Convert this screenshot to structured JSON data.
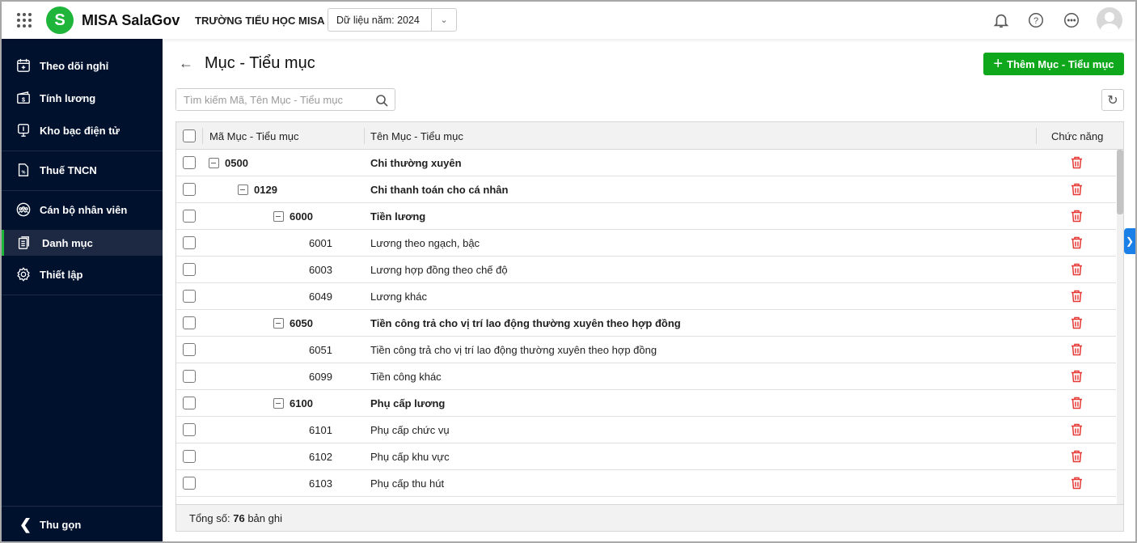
{
  "header": {
    "app_name": "MISA SalaGov",
    "school": "TRƯỜNG TIỂU HỌC MISA",
    "year_label": "Dữ liệu năm:",
    "year": "2024"
  },
  "sidebar": {
    "items": [
      {
        "label": "Theo dõi nghỉ",
        "icon": "calendar-icon"
      },
      {
        "label": "Tính lương",
        "icon": "wallet-icon"
      },
      {
        "label": "Kho bạc điện tử",
        "icon": "treasury-icon"
      },
      {
        "label": "Thuế TNCN",
        "icon": "tax-document-icon"
      },
      {
        "label": "Cán bộ nhân viên",
        "icon": "people-icon"
      },
      {
        "label": "Danh mục",
        "icon": "catalog-icon",
        "active": true
      },
      {
        "label": "Thiết lập",
        "icon": "gear-icon"
      }
    ],
    "collapse": "Thu gọn"
  },
  "page": {
    "title": "Mục - Tiểu mục",
    "add_button": "Thêm Mục - Tiểu mục",
    "search_placeholder": "Tìm kiếm Mã, Tên Mục - Tiểu mục"
  },
  "table": {
    "columns": {
      "code": "Mã Mục - Tiểu mục",
      "name": "Tên Mục - Tiểu mục",
      "action": "Chức năng"
    },
    "rows": [
      {
        "code": "0500",
        "name": "Chi thường xuyên",
        "level": 0,
        "group": true
      },
      {
        "code": "0129",
        "name": "Chi thanh toán cho cá nhân",
        "level": 1,
        "group": true
      },
      {
        "code": "6000",
        "name": "Tiền lương",
        "level": 2,
        "group": true
      },
      {
        "code": "6001",
        "name": "Lương theo ngạch, bậc",
        "level": 3,
        "group": false
      },
      {
        "code": "6003",
        "name": "Lương hợp đồng theo chế độ",
        "level": 3,
        "group": false
      },
      {
        "code": "6049",
        "name": "Lương khác",
        "level": 3,
        "group": false
      },
      {
        "code": "6050",
        "name": "Tiền công trả cho vị trí lao động thường xuyên theo hợp đồng",
        "level": 2,
        "group": true
      },
      {
        "code": "6051",
        "name": "Tiền công trả cho vị trí lao động thường xuyên theo hợp đồng",
        "level": 3,
        "group": false
      },
      {
        "code": "6099",
        "name": "Tiền công khác",
        "level": 3,
        "group": false
      },
      {
        "code": "6100",
        "name": "Phụ cấp lương",
        "level": 2,
        "group": true
      },
      {
        "code": "6101",
        "name": "Phụ cấp chức vụ",
        "level": 3,
        "group": false
      },
      {
        "code": "6102",
        "name": "Phụ cấp khu vực",
        "level": 3,
        "group": false
      },
      {
        "code": "6103",
        "name": "Phụ cấp thu hút",
        "level": 3,
        "group": false
      }
    ],
    "footer": {
      "label": "Tổng số:",
      "count": "76",
      "suffix": "bản ghi"
    }
  },
  "colors": {
    "brand": "#1eb53a",
    "primary_button": "#0fa81c",
    "sidebar": "#00112e",
    "delete": "#e53935"
  }
}
